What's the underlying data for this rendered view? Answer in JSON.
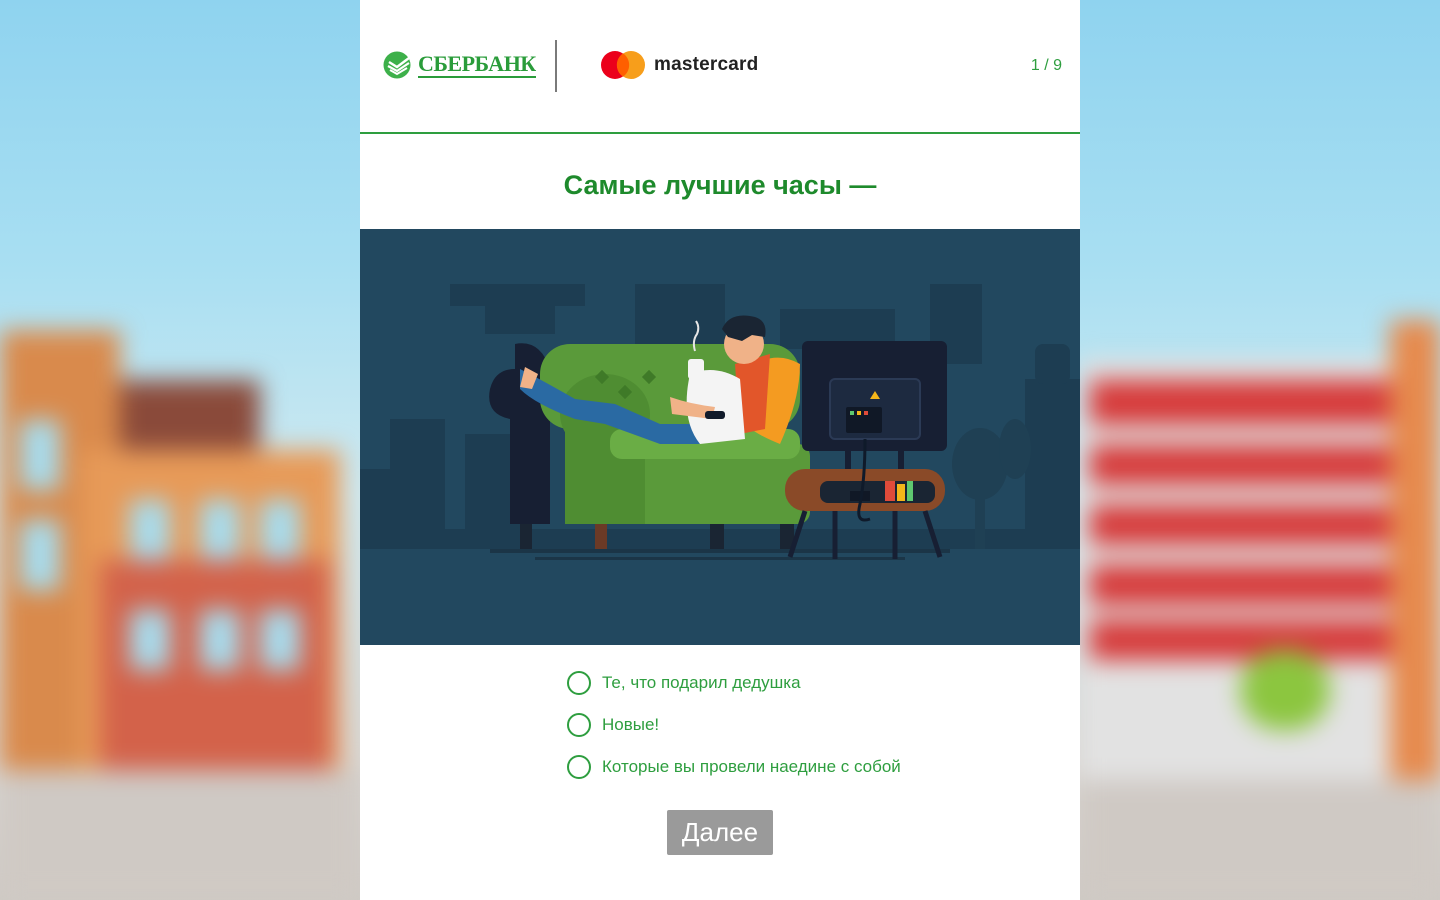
{
  "brand": {
    "bank_name": "СБЕРБАНК",
    "partner_name": "mastercard"
  },
  "progress": {
    "label": "1 / 9",
    "current": 1,
    "total": 9
  },
  "quiz": {
    "question": "Самые лучшие часы —",
    "options": [
      {
        "label": "Те, что подарил дедушка",
        "selected": false
      },
      {
        "label": "Новые!",
        "selected": false
      },
      {
        "label": "Которые вы провели наедине с собой",
        "selected": false
      }
    ],
    "next_label": "Далее"
  },
  "colors": {
    "accent_green": "#2e9e3f",
    "illustration_bg": "#22485f",
    "button_disabled": "#9a9a9a",
    "mastercard_red": "#eb001b",
    "mastercard_orange": "#f79e1b"
  },
  "icons": [
    "sberbank-logo-icon",
    "mastercard-logo-icon",
    "radio-icon"
  ]
}
